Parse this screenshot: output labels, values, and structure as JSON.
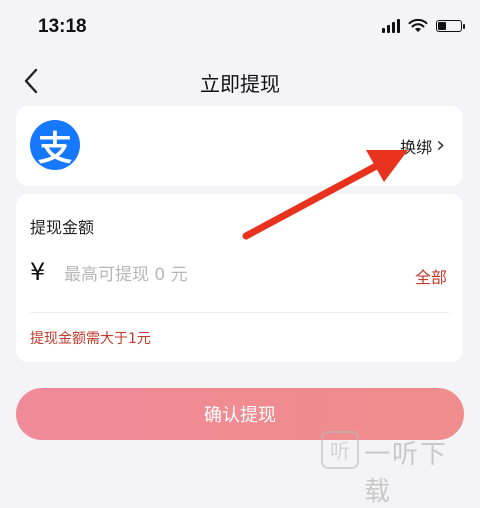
{
  "status_bar": {
    "time": "13:18"
  },
  "nav": {
    "title": "立即提现"
  },
  "account": {
    "logo_glyph": "支",
    "rebind_label": "换绑",
    "rebind_chevron": "›",
    "brand_color": "#1677ff"
  },
  "amount": {
    "label": "提现金额",
    "currency": "¥",
    "placeholder": "最高可提现 0 元",
    "value": "",
    "all_label": "全部",
    "hint": "提现金额需大于1元"
  },
  "confirm": {
    "label": "确认提现"
  },
  "watermark": {
    "text": "一听下载"
  },
  "colors": {
    "accent_red": "#c0392b",
    "button_pink": "#f08a98",
    "annotation_arrow": "#e8321e"
  }
}
